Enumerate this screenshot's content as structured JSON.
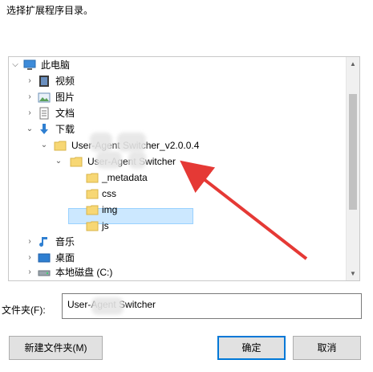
{
  "dialog": {
    "prompt": "选择扩展程序目录。"
  },
  "tree": {
    "items": [
      {
        "label": "此电脑"
      },
      {
        "label": "视频"
      },
      {
        "label": "图片"
      },
      {
        "label": "文档"
      },
      {
        "label": "下载"
      },
      {
        "label": "User-Agent Switcher_v2.0.0.4"
      },
      {
        "label": "User-Agent Switcher"
      },
      {
        "label": "_metadata"
      },
      {
        "label": "css"
      },
      {
        "label": "img"
      },
      {
        "label": "js"
      },
      {
        "label": "音乐"
      },
      {
        "label": "桌面"
      },
      {
        "label": "本地磁盘 (C:)"
      }
    ]
  },
  "folder": {
    "label": "文件夹(F):",
    "value": "User-Agent Switcher"
  },
  "buttons": {
    "new_folder": "新建文件夹(M)",
    "ok": "确定",
    "cancel": "取消"
  },
  "colors": {
    "selection": "#cce8ff",
    "annotation_arrow": "#e53935",
    "folder_yellow": "#f7d774"
  },
  "icons": {
    "computer": "computer-icon",
    "video": "video-folder-icon",
    "pictures": "pictures-folder-icon",
    "documents": "documents-folder-icon",
    "downloads": "download-arrow-icon",
    "folder": "folder-icon",
    "music": "music-note-icon",
    "desktop": "desktop-icon",
    "drive": "drive-icon"
  }
}
